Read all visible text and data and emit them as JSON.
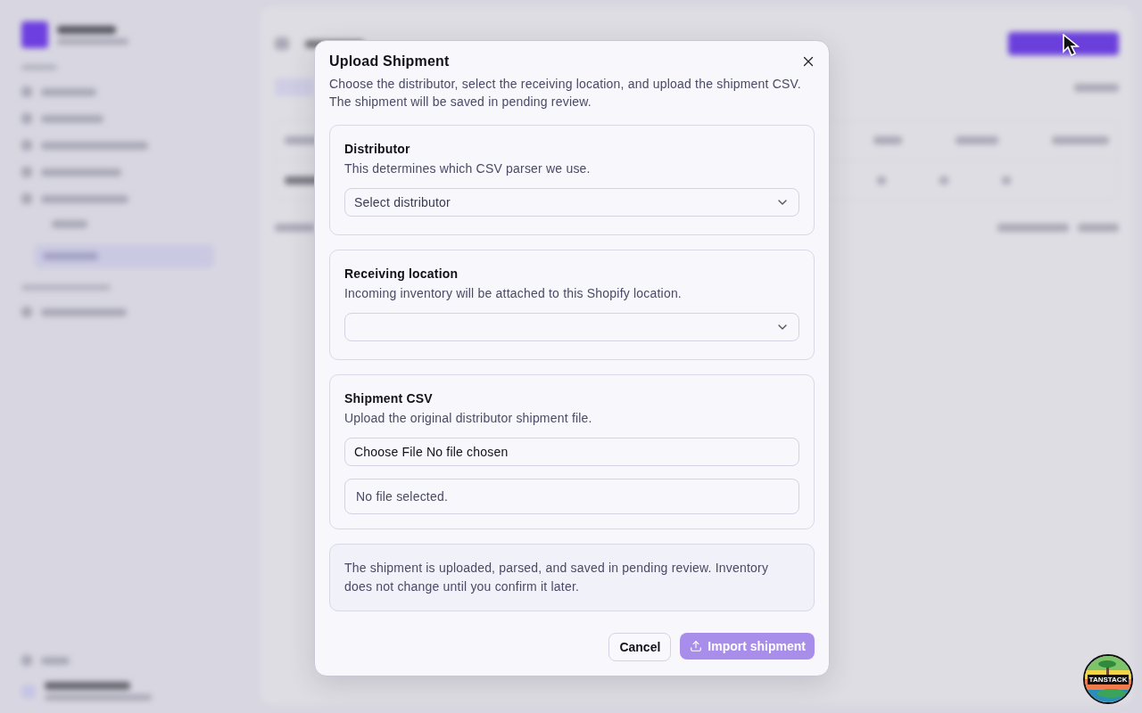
{
  "dialog": {
    "title": "Upload Shipment",
    "description": "Choose the distributor, select the receiving location, and upload the shipment CSV. The shipment will be saved in pending review.",
    "sections": [
      {
        "kind": "select",
        "title": "Distributor",
        "hint": "This determines which CSV parser we use.",
        "placeholder": "Select distributor"
      },
      {
        "kind": "select",
        "title": "Receiving location",
        "hint": "Incoming inventory will be attached to this Shopify location."
      },
      {
        "kind": "file",
        "title": "Shipment CSV",
        "hint": "Upload the original distributor shipment file.",
        "button": "Choose File",
        "file_status": "No file chosen",
        "selection": "No file selected."
      }
    ],
    "note": "The shipment is uploaded, parsed, and saved in pending review. Inventory does not change until you confirm it later.",
    "cancel": "Cancel",
    "submit": {
      "label": "Import shipment",
      "disabled": true
    }
  },
  "devtools_badge": {
    "label": "TANSTACK"
  }
}
